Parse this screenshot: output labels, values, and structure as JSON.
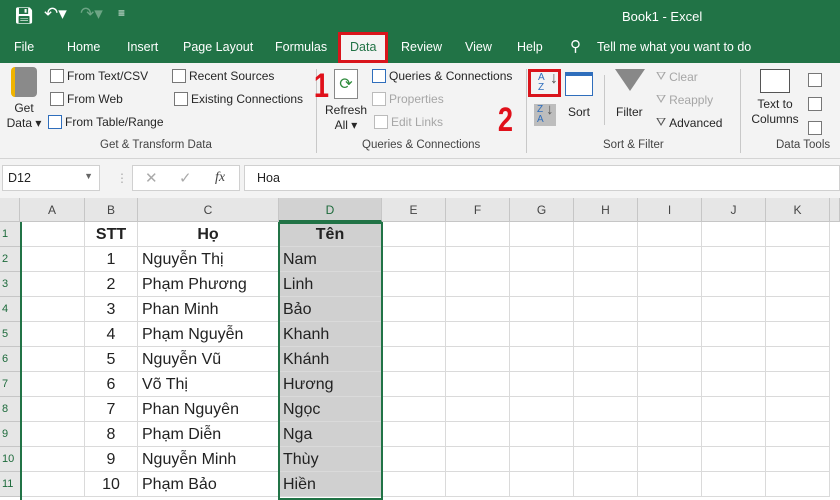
{
  "titlebar": {
    "title": "Book1  -  Excel"
  },
  "tabs": [
    {
      "label": "File"
    },
    {
      "label": "Home"
    },
    {
      "label": "Insert"
    },
    {
      "label": "Page Layout"
    },
    {
      "label": "Formulas"
    },
    {
      "label": "Data",
      "active": true
    },
    {
      "label": "Review"
    },
    {
      "label": "View"
    },
    {
      "label": "Help"
    }
  ],
  "tell_me": "Tell me what you want to do",
  "ribbon": {
    "get_data": [
      "Get",
      "Data ▾"
    ],
    "from_text": "From Text/CSV",
    "from_web": "From Web",
    "from_table": "From Table/Range",
    "recent": "Recent Sources",
    "existing": "Existing Connections",
    "group1": "Get & Transform Data",
    "refresh": [
      "Refresh",
      "All ▾"
    ],
    "queries": "Queries & Connections",
    "properties": "Properties",
    "edit_links": "Edit Links",
    "group2": "Queries & Connections",
    "sort": "Sort",
    "filter": "Filter",
    "clear": "Clear",
    "reapply": "Reapply",
    "advanced": "Advanced",
    "group3": "Sort & Filter",
    "text_to_columns": [
      "Text to",
      "Columns"
    ],
    "group4": "Data Tools",
    "az": "A\nZ",
    "za": "Z\nA"
  },
  "annotations": {
    "step1": "1",
    "step2": "2",
    "highlight_color": "#d9141b"
  },
  "formula_bar": {
    "name_box": "D12",
    "formula": "Hoa",
    "fx": "fx"
  },
  "columns": [
    "A",
    "B",
    "C",
    "D",
    "E",
    "F",
    "G",
    "H",
    "I",
    "J",
    "K"
  ],
  "rows": [
    "1",
    "2",
    "3",
    "4",
    "5",
    "6",
    "7",
    "8",
    "9",
    "10",
    "11"
  ],
  "table": {
    "headers": [
      "STT",
      "Họ",
      "Tên"
    ],
    "data": [
      [
        "1",
        "Nguyễn Thị",
        "Nam"
      ],
      [
        "2",
        "Phạm Phương",
        "Linh"
      ],
      [
        "3",
        "Phan Minh",
        "Bảo"
      ],
      [
        "4",
        "Phạm Nguyễn",
        "Khanh"
      ],
      [
        "5",
        "Nguyễn Vũ",
        "Khánh"
      ],
      [
        "6",
        "Võ Thị",
        "Hương"
      ],
      [
        "7",
        "Phan Nguyên",
        "Ngọc"
      ],
      [
        "8",
        "Phạm Diễn",
        "Nga"
      ],
      [
        "9",
        "Nguyễn  Minh",
        "Thùy"
      ],
      [
        "10",
        "Phạm Bảo",
        "Hiền"
      ]
    ]
  },
  "colors": {
    "excel_green": "#217346",
    "selection": "#d0d0d0"
  }
}
